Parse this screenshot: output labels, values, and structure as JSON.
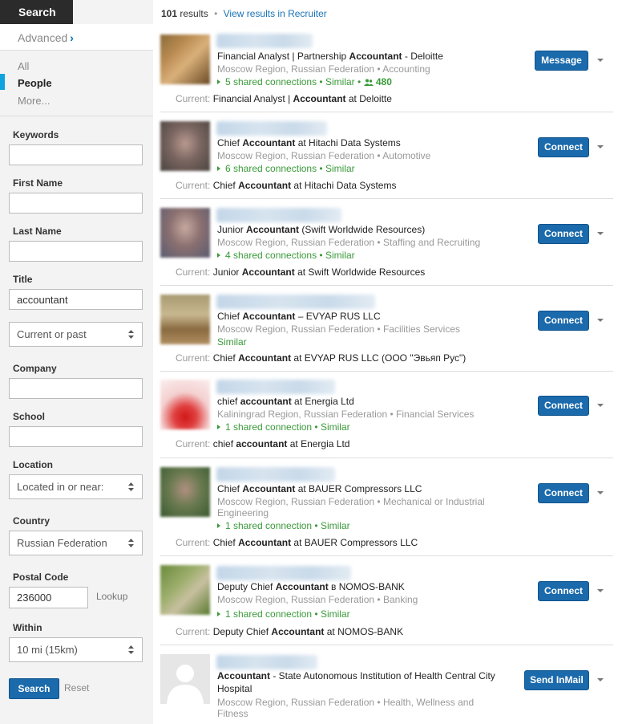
{
  "sidebar": {
    "search_tab": "Search",
    "advanced_link": "Advanced",
    "filter_types": [
      {
        "label": "All"
      },
      {
        "label": "People"
      },
      {
        "label": "More..."
      }
    ],
    "fields": {
      "keywords_label": "Keywords",
      "keywords_value": "",
      "first_name_label": "First Name",
      "first_name_value": "",
      "last_name_label": "Last Name",
      "last_name_value": "",
      "title_label": "Title",
      "title_value": "accountant",
      "title_scope": "Current or past",
      "company_label": "Company",
      "company_value": "",
      "school_label": "School",
      "school_value": "",
      "location_label": "Location",
      "location_value": "Located in or near:",
      "country_label": "Country",
      "country_value": "Russian Federation",
      "postal_label": "Postal Code",
      "postal_value": "236000",
      "lookup_link": "Lookup",
      "within_label": "Within",
      "within_value": "10 mi (15km)"
    },
    "search_button": "Search",
    "reset_link": "Reset"
  },
  "main": {
    "results_count": "101",
    "results_word": "results",
    "separator": "•",
    "recruiter_link": "View results in Recruiter",
    "current_label": "Current:",
    "results": [
      {
        "headline_pre": "Financial Analyst | Partnership ",
        "headline_bold": "Accountant",
        "headline_post": " - Deloitte",
        "location_industry": "Moscow Region, Russian Federation • Accounting",
        "connections": "5 shared connections • Similar •",
        "connections_count": "480",
        "current_pre": "Financial Analyst | ",
        "current_bold": "Accountant",
        "current_post": " at Deloitte",
        "action": "Message"
      },
      {
        "headline_pre": "Chief ",
        "headline_bold": "Accountant",
        "headline_post": " at Hitachi Data Systems",
        "location_industry": "Moscow Region, Russian Federation • Automotive",
        "connections": "6 shared connections • Similar",
        "current_pre": "Chief ",
        "current_bold": "Accountant",
        "current_post": " at Hitachi Data Systems",
        "action": "Connect"
      },
      {
        "headline_pre": "Junior ",
        "headline_bold": "Accountant",
        "headline_post": " (Swift Worldwide Resources)",
        "location_industry": "Moscow Region, Russian Federation • Staffing and Recruiting",
        "connections": "4 shared connections • Similar",
        "current_pre": "Junior ",
        "current_bold": "Accountant",
        "current_post": " at Swift Worldwide Resources",
        "action": "Connect"
      },
      {
        "headline_pre": "Chief ",
        "headline_bold": "Accountant",
        "headline_post": " – EVYAP RUS LLC",
        "location_industry": "Moscow Region, Russian Federation • Facilities Services",
        "connections": "Similar",
        "current_pre": "Chief ",
        "current_bold": "Accountant",
        "current_post": " at EVYAP RUS LLC (ООО \"Эвьяп Рус\")",
        "action": "Connect"
      },
      {
        "headline_pre": "chief ",
        "headline_bold": "accountant",
        "headline_post": " at Energia Ltd",
        "location_industry": "Kaliningrad Region, Russian Federation • Financial Services",
        "connections": "1 shared connection • Similar",
        "current_pre": "chief ",
        "current_bold": "accountant",
        "current_post": " at Energia Ltd",
        "action": "Connect"
      },
      {
        "headline_pre": "Chief ",
        "headline_bold": "Accountant",
        "headline_post": " at BAUER Compressors LLC",
        "location_industry": "Moscow Region, Russian Federation • Mechanical or Industrial Engineering",
        "connections": "1 shared connection • Similar",
        "current_pre": "Chief ",
        "current_bold": "Accountant",
        "current_post": " at BAUER Compressors LLC",
        "action": "Connect"
      },
      {
        "headline_pre": "Deputy Chief ",
        "headline_bold": "Accountant",
        "headline_post": " в NOMOS-BANK",
        "location_industry": "Moscow Region, Russian Federation • Banking",
        "connections": "1 shared connection • Similar",
        "current_pre": "Deputy Chief ",
        "current_bold": "Accountant",
        "current_post": " at NOMOS-BANK",
        "action": "Connect"
      },
      {
        "headline_pre": "",
        "headline_bold": "Accountant",
        "headline_post": " - State Autonomous Institution of Health Central City Hospital",
        "location_industry": "Moscow Region, Russian Federation • Health, Wellness and Fitness",
        "action": "Send InMail"
      }
    ]
  },
  "colors": {
    "button_blue": "#1b6aab",
    "link_blue": "#1a73b5",
    "connection_green": "#3a9a3a",
    "sidebar_bg": "#f3f3f3",
    "active_marker": "#0fa3e0"
  }
}
